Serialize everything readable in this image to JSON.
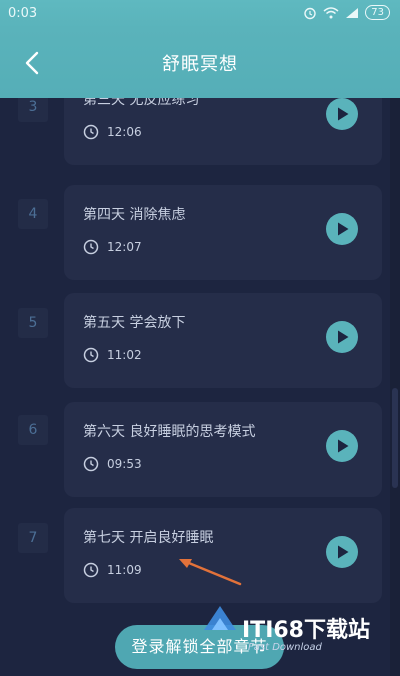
{
  "status_bar": {
    "time": "0:03",
    "battery": "73"
  },
  "header": {
    "title": "舒眠冥想"
  },
  "lessons": [
    {
      "index": "3",
      "title": "第三天 无反应练习",
      "duration": "12:06"
    },
    {
      "index": "4",
      "title": "第四天 消除焦虑",
      "duration": "12:07"
    },
    {
      "index": "5",
      "title": "第五天 学会放下",
      "duration": "11:02"
    },
    {
      "index": "6",
      "title": "第六天 良好睡眠的思考模式",
      "duration": "09:53"
    },
    {
      "index": "7",
      "title": "第七天 开启良好睡眠",
      "duration": "11:09"
    }
  ],
  "footer": {
    "login_button": "登录解锁全部章节"
  },
  "watermark": {
    "brand": "ITI68下载站",
    "sub": "Fast Download"
  },
  "colors": {
    "accent": "#5ab3bb",
    "background": "#1d2540",
    "card": "#252d49",
    "button": "#4fa7b2",
    "annotation_arrow": "#e2723a"
  }
}
